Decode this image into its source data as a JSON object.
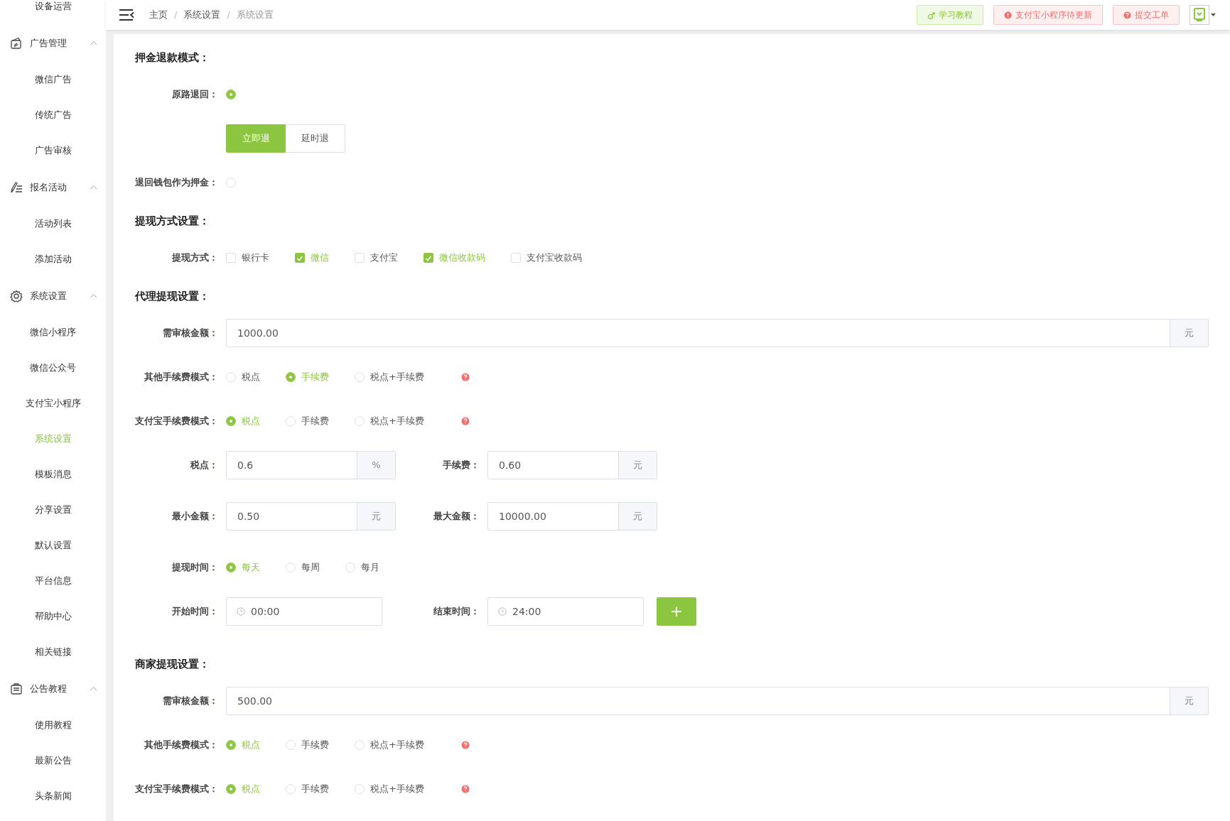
{
  "sidebar": {
    "top_item": {
      "label": "设备运营"
    },
    "groups": [
      {
        "label": "广告管理",
        "expanded": true,
        "children": [
          {
            "label": "微信广告",
            "selected": false
          },
          {
            "label": "传统广告",
            "selected": false
          },
          {
            "label": "广告审核",
            "selected": false
          }
        ]
      },
      {
        "label": "报名活动",
        "expanded": true,
        "children": [
          {
            "label": "活动列表",
            "selected": false
          },
          {
            "label": "添加活动",
            "selected": false
          }
        ]
      },
      {
        "label": "系统设置",
        "expanded": true,
        "children": [
          {
            "label": "微信小程序",
            "selected": false
          },
          {
            "label": "微信公众号",
            "selected": false
          },
          {
            "label": "支付宝小程序",
            "selected": false
          },
          {
            "label": "系统设置",
            "selected": true
          },
          {
            "label": "模板消息",
            "selected": false
          },
          {
            "label": "分享设置",
            "selected": false
          },
          {
            "label": "默认设置",
            "selected": false
          },
          {
            "label": "平台信息",
            "selected": false
          },
          {
            "label": "帮助中心",
            "selected": false
          },
          {
            "label": "相关链接",
            "selected": false
          }
        ]
      },
      {
        "label": "公告教程",
        "expanded": true,
        "children": [
          {
            "label": "使用教程",
            "selected": false
          },
          {
            "label": "最新公告",
            "selected": false
          },
          {
            "label": "头条新闻",
            "selected": false
          }
        ]
      }
    ]
  },
  "topbar": {
    "breadcrumb": [
      "主页",
      "系统设置",
      "系统设置"
    ],
    "breadcrumb_separator": "/",
    "buttons": [
      {
        "label": "学习教程",
        "kind": "success"
      },
      {
        "label": "支付宝小程序待更新",
        "kind": "danger"
      },
      {
        "label": "提交工单",
        "kind": "danger"
      }
    ]
  },
  "sections": [
    {
      "title": "押金退款模式：",
      "rows": [
        {
          "kind": "toggle",
          "label": "原路退回：",
          "checked": true
        },
        {
          "kind": "segmented",
          "options": [
            {
              "label": "立即退",
              "selected": true
            },
            {
              "label": "延时退",
              "selected": false
            }
          ]
        },
        {
          "kind": "toggle",
          "label": "退回钱包作为押金：",
          "checked": false
        }
      ]
    },
    {
      "title": "提现方式设置：",
      "rows": [
        {
          "kind": "checkboxes",
          "label": "提现方式：",
          "options": [
            {
              "label": "银行卡",
              "checked": false
            },
            {
              "label": "微信",
              "checked": true
            },
            {
              "label": "支付宝",
              "checked": false
            },
            {
              "label": "微信收款码",
              "checked": true
            },
            {
              "label": "支付宝收款码",
              "checked": false
            }
          ]
        }
      ]
    },
    {
      "title": "代理提现设置：",
      "rows": [
        {
          "kind": "input",
          "label": "需审核金额：",
          "value": "1000.00",
          "addon": "元"
        },
        {
          "kind": "radios",
          "label": "其他手续费模式：",
          "help": true,
          "options": [
            {
              "label": "税点",
              "selected": false
            },
            {
              "label": "手续费",
              "selected": true
            },
            {
              "label": "税点+手续费",
              "selected": false
            }
          ]
        },
        {
          "kind": "radios",
          "label": "支付宝手续费模式：",
          "help": true,
          "options": [
            {
              "label": "税点",
              "selected": true
            },
            {
              "label": "手续费",
              "selected": false
            },
            {
              "label": "税点+手续费",
              "selected": false
            }
          ]
        },
        {
          "kind": "input_pair",
          "fields": [
            {
              "label": "税点：",
              "value": "0.6",
              "addon": "%"
            },
            {
              "label": "手续费：",
              "value": "0.60",
              "addon": "元"
            }
          ]
        },
        {
          "kind": "input_pair",
          "fields": [
            {
              "label": "最小金额：",
              "value": "0.50",
              "addon": "元"
            },
            {
              "label": "最大金额：",
              "value": "10000.00",
              "addon": "元"
            }
          ]
        },
        {
          "kind": "radios",
          "label": "提现时间：",
          "options": [
            {
              "label": "每天",
              "selected": true
            },
            {
              "label": "每周",
              "selected": false
            },
            {
              "label": "每月",
              "selected": false
            }
          ]
        },
        {
          "kind": "time_pair",
          "fields": [
            {
              "label": "开始时间：",
              "value": "00:00"
            },
            {
              "label": "结束时间：",
              "value": "24:00"
            }
          ],
          "add_button": "+"
        }
      ]
    },
    {
      "title": "商家提现设置：",
      "rows": [
        {
          "kind": "input",
          "label": "需审核金额：",
          "value": "500.00",
          "addon": "元"
        },
        {
          "kind": "radios",
          "label": "其他手续费模式：",
          "help": true,
          "options": [
            {
              "label": "税点",
              "selected": true
            },
            {
              "label": "手续费",
              "selected": false
            },
            {
              "label": "税点+手续费",
              "selected": false
            }
          ]
        },
        {
          "kind": "radios",
          "label": "支付宝手续费模式：",
          "help": true,
          "options": [
            {
              "label": "税点",
              "selected": true
            },
            {
              "label": "手续费",
              "selected": false
            },
            {
              "label": "税点+手续费",
              "selected": false
            }
          ]
        }
      ]
    }
  ]
}
